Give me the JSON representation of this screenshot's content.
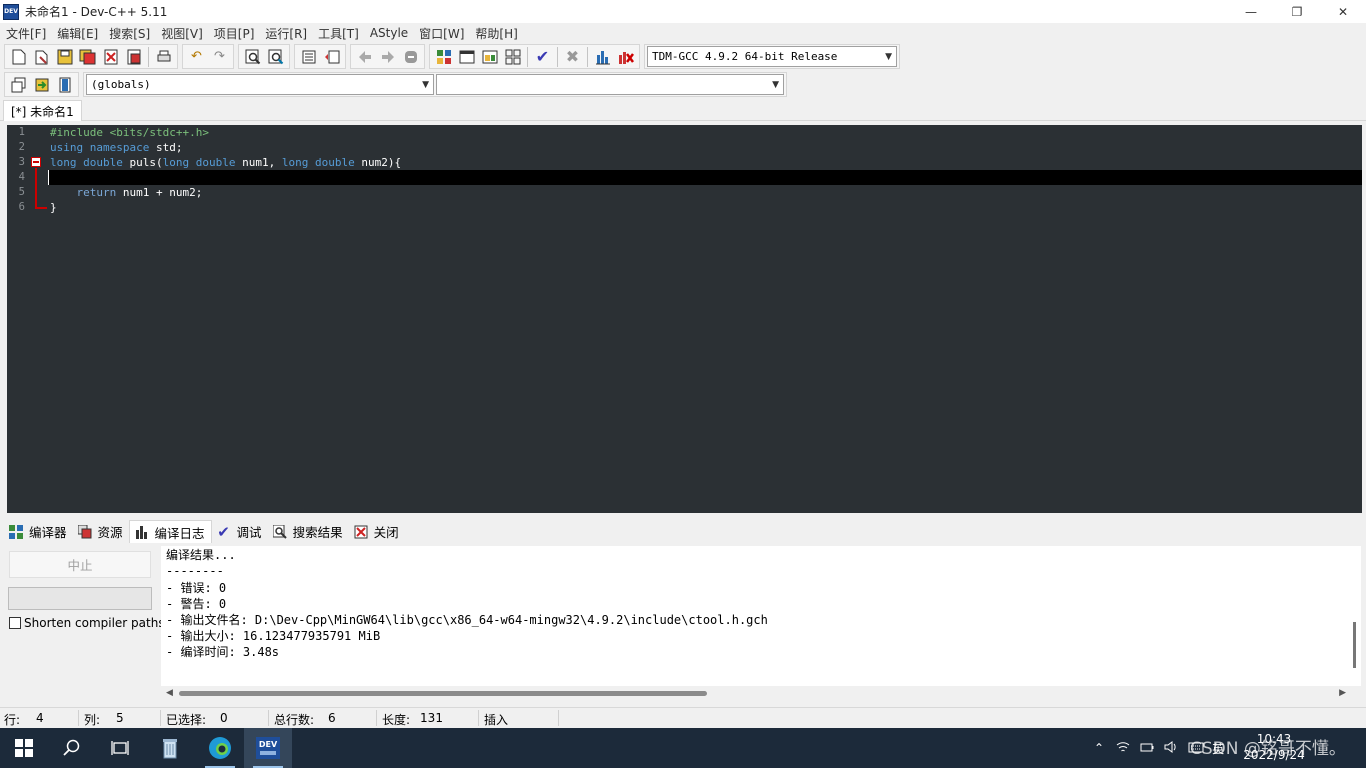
{
  "window": {
    "title": "未命名1 - Dev-C++ 5.11",
    "logo_text": "DEV",
    "controls": [
      "—",
      "❐",
      "✕"
    ]
  },
  "menu": [
    "文件[F]",
    "编辑[E]",
    "搜索[S]",
    "视图[V]",
    "项目[P]",
    "运行[R]",
    "工具[T]",
    "AStyle",
    "窗口[W]",
    "帮助[H]"
  ],
  "toolbar": {
    "compiler_select": "TDM-GCC 4.9.2 64-bit Release",
    "scope_select": "(globals)",
    "member_select": ""
  },
  "editor": {
    "tab_label": "[*] 未命名1",
    "line_numbers": [
      "1",
      "2",
      "3",
      "4",
      "5",
      "6"
    ],
    "lines": [
      {
        "parts": [
          {
            "cls": "kw-pre",
            "text": "#include <bits/stdc++.h>"
          }
        ]
      },
      {
        "parts": [
          {
            "cls": "kw",
            "text": "using"
          },
          {
            "cls": "plain",
            "text": " "
          },
          {
            "cls": "kw",
            "text": "namespace"
          },
          {
            "cls": "plain",
            "text": " std;"
          }
        ]
      },
      {
        "parts": [
          {
            "cls": "kw",
            "text": "long"
          },
          {
            "cls": "plain",
            "text": " "
          },
          {
            "cls": "kw",
            "text": "double"
          },
          {
            "cls": "plain",
            "text": " puls("
          },
          {
            "cls": "kw",
            "text": "long"
          },
          {
            "cls": "plain",
            "text": " "
          },
          {
            "cls": "kw",
            "text": "double"
          },
          {
            "cls": "plain",
            "text": " num1, "
          },
          {
            "cls": "kw",
            "text": "long"
          },
          {
            "cls": "plain",
            "text": " "
          },
          {
            "cls": "kw",
            "text": "double"
          },
          {
            "cls": "plain",
            "text": " num2){"
          }
        ]
      },
      {
        "parts": []
      },
      {
        "parts": [
          {
            "cls": "plain",
            "text": "    "
          },
          {
            "cls": "kw-ret",
            "text": "return"
          },
          {
            "cls": "plain",
            "text": " num1 + num2;"
          }
        ]
      },
      {
        "parts": [
          {
            "cls": "plain",
            "text": "}"
          }
        ]
      }
    ]
  },
  "bottom_tabs": [
    {
      "label": "编译器",
      "icon": "grid-icon"
    },
    {
      "label": "资源",
      "icon": "resources-icon"
    },
    {
      "label": "编译日志",
      "icon": "bar-chart-icon",
      "active": true
    },
    {
      "label": "调试",
      "icon": "check-icon"
    },
    {
      "label": "搜索结果",
      "icon": "search-icon"
    },
    {
      "label": "关闭",
      "icon": "close-icon"
    }
  ],
  "compile_panel": {
    "abort_label": "中止",
    "shorten_label": "Shorten compiler paths",
    "log_lines": [
      "编译结果...",
      "--------",
      "- 错误: 0",
      "- 警告: 0",
      "- 输出文件名: D:\\Dev-Cpp\\MinGW64\\lib\\gcc\\x86_64-w64-mingw32\\4.9.2\\include\\ctool.h.gch",
      "- 输出大小: 16.123477935791 MiB",
      "- 编译时间: 3.48s"
    ]
  },
  "status": {
    "row_label": "行:",
    "row_value": "4",
    "col_label": "列:",
    "col_value": "5",
    "sel_label": "已选择:",
    "sel_value": "0",
    "lines_label": "总行数:",
    "lines_value": "6",
    "len_label": "长度:",
    "len_value": "131",
    "mode": "插入"
  },
  "taskbar": {
    "time": "10:43",
    "date": "2022/9/24",
    "ime_label": "英",
    "watermark": "CSDN @铭哥不懂。"
  },
  "colors": {
    "editor_bg": "#2b3034",
    "keyword": "#569cd6",
    "preprocessor": "#7bbf7b",
    "fold_marker": "#cc0000",
    "taskbar_bg": "#1c2a3a"
  }
}
